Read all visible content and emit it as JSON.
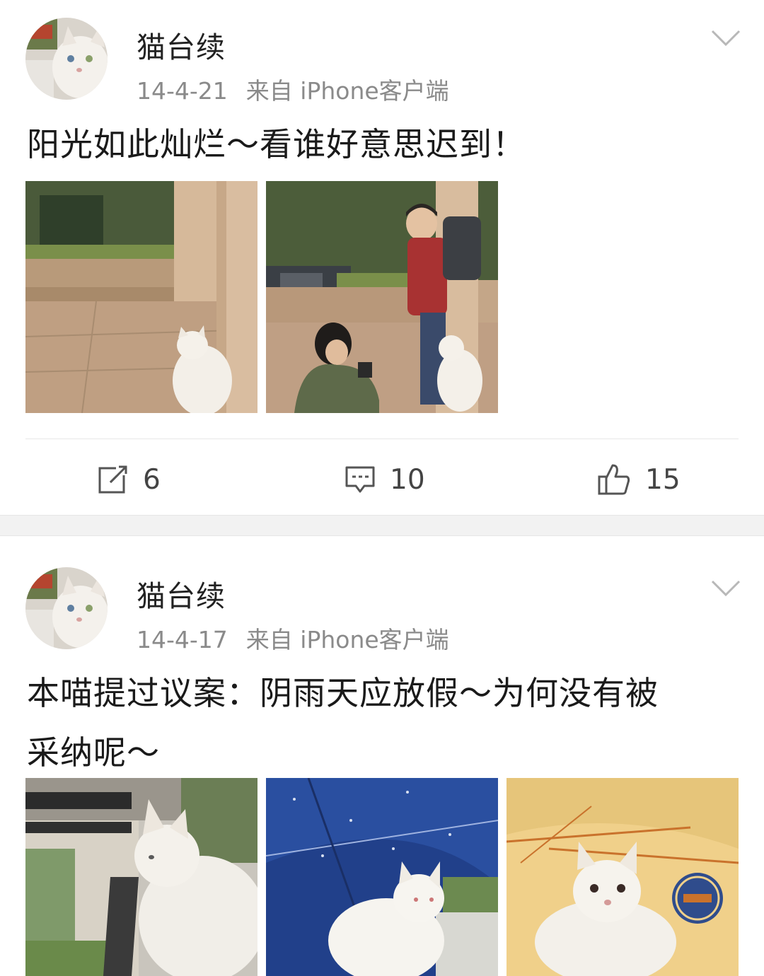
{
  "posts": [
    {
      "username": "猫台续",
      "date": "14-4-21",
      "source": "来自 iPhone客户端",
      "text": "阳光如此灿烂～看谁好意思迟到！",
      "actions": {
        "repost_count": "6",
        "comment_count": "10",
        "like_count": "15"
      },
      "photo_icons": [
        "cat-photo",
        "cat-with-people-photo"
      ]
    },
    {
      "username": "猫台续",
      "date": "14-4-17",
      "source": "来自 iPhone客户端",
      "text_line1": "本喵提过议案：阴雨天应放假～为何没有被",
      "text_line2": "采纳呢～",
      "photo_icons": [
        "cat-at-window-photo",
        "cat-under-blue-umbrella-photo",
        "cat-under-yellow-umbrella-photo"
      ]
    }
  ],
  "colors": {
    "meta_gray": "#8a8a8a",
    "divider_band": "#f2f2f2",
    "text": "#1a1a1a"
  }
}
